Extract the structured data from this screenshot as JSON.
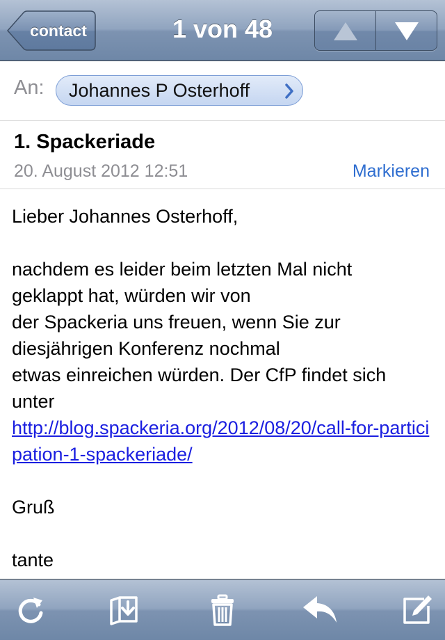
{
  "navbar": {
    "back_label": "contact",
    "title": "1 von 48",
    "prev_icon": "triangle-up-icon",
    "next_icon": "triangle-down-icon"
  },
  "recipient": {
    "label": "An:",
    "name": "Johannes P Osterhoff"
  },
  "message": {
    "subject": "1. Spackeriade",
    "date": "20. August 2012 12:51",
    "mark_label": "Markieren",
    "body": {
      "greeting": "Lieber Johannes Osterhoff,",
      "paragraph": "nachdem es leider beim letzten Mal nicht\ngeklappt hat, würden wir von\nder Spackeria uns freuen, wenn Sie zur\ndiesjährigen Konferenz nochmal\netwas einreichen würden. Der CfP findet sich\nunter",
      "link": "http://blog.spackeria.org/2012/08/20/call-for-participation-1-spackeriade/",
      "closing": "Gruß",
      "signature": "tante"
    }
  },
  "toolbar": {
    "icons": [
      "refresh-icon",
      "move-to-folder-icon",
      "trash-icon",
      "reply-icon",
      "compose-icon"
    ]
  },
  "colors": {
    "bar_top": "#b4c2d5",
    "bar_bottom": "#6e87a7",
    "link": "#1a1ee0",
    "accent": "#2f6ed0"
  }
}
